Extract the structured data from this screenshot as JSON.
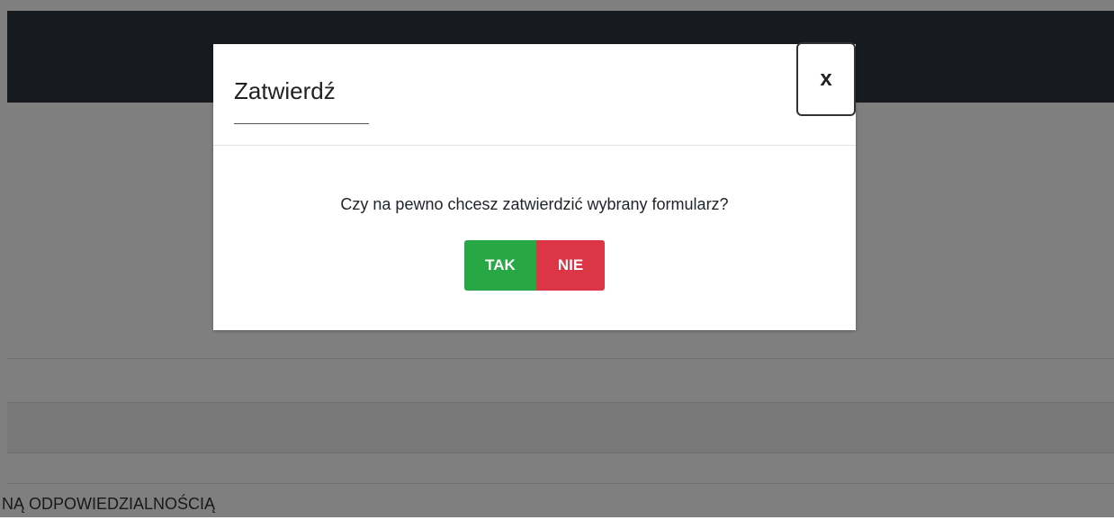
{
  "background": {
    "partial_row_text": "NĄ ODPOWIEDZIALNOŚCIĄ"
  },
  "dialog": {
    "title": "Zatwierdź",
    "close_label": "x",
    "message": "Czy na pewno chcesz zatwierdzić wybrany formularz?",
    "confirm_label": "TAK",
    "cancel_label": "NIE"
  },
  "colors": {
    "topbar": "#2e353d",
    "confirm": "#28a745",
    "cancel": "#dc3545",
    "overlay": "rgba(0,0,0,0.5)"
  }
}
